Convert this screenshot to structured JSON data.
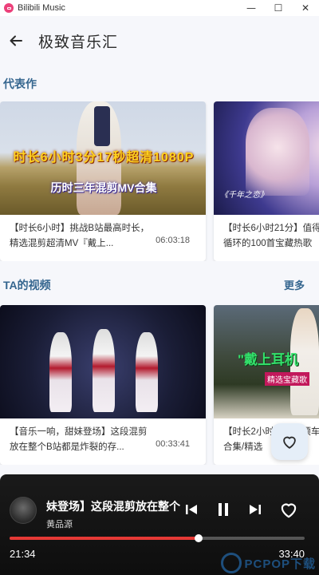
{
  "window": {
    "title": "Bilibili Music",
    "controls": {
      "minimize": "—",
      "maximize": "☐",
      "close": "✕"
    }
  },
  "header": {
    "back_icon": "arrow-left-icon",
    "title": "极致音乐汇"
  },
  "sections": [
    {
      "title": "代表作",
      "items": [
        {
          "title": "【时长6小时】挑战B站最高时长，精选混剪超清MV『戴上...",
          "duration": "06:03:18",
          "thumb_caption": "时长6小时3分17秒超清1080P",
          "thumb_subcaption": "历时三年混剪MV合集"
        },
        {
          "title": "【时长6小时21分】值得循环的100首宝藏热歌",
          "duration": "",
          "thumb_caption": "《千年之恋》"
        }
      ]
    },
    {
      "title": "TA的视频",
      "more": "更多",
      "items": [
        {
          "title": "【音乐一响，甜妹登场】这段混剪放在整个B站都是炸裂的存...",
          "duration": "00:33:41"
        },
        {
          "title": "【时长2小时】百万顶车合集/精选",
          "duration": "",
          "thumb_caption": "\"戴上耳机",
          "thumb_badge": "精选宝藏歌"
        }
      ]
    }
  ],
  "fab": {
    "icon": "heart-outline-icon"
  },
  "player": {
    "song_title": "妹登场】这段混剪放在整个",
    "artist": "黄品源",
    "current_time": "21:34",
    "total_time": "33:40",
    "progress": 0.64
  },
  "watermark": {
    "text": "PCPOP下载"
  },
  "colors": {
    "accent": "#35668f",
    "progress": "#e53935",
    "brand": "#ec407a"
  }
}
